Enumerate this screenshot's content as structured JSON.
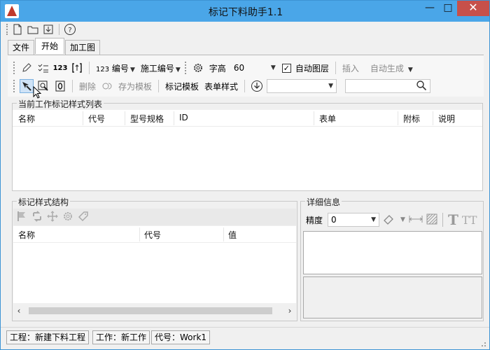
{
  "window": {
    "title": "标记下料助手1.1",
    "minimize_glyph": "—",
    "maximize_glyph": "□",
    "close_glyph": "✕"
  },
  "quick_access": {
    "icons": [
      "new-file-icon",
      "open-folder-icon",
      "save-icon",
      "help-icon"
    ],
    "help_glyph": "?"
  },
  "tabs": [
    {
      "label": "文件",
      "active": false
    },
    {
      "label": "开始",
      "active": true
    },
    {
      "label": "加工图",
      "active": false
    }
  ],
  "ribbon": {
    "row1": {
      "number_btn": "编号",
      "number_prefix": "123",
      "construction_number_btn": "施工编号",
      "font_height_label": "字高",
      "font_height_value": "60",
      "auto_layer_label": "自动图层",
      "auto_layer_checked": true,
      "insert_btn": "插入",
      "auto_generate_btn": "自动生成"
    },
    "row2": {
      "delete_btn": "删除",
      "save_template_btn": "存为模板",
      "mark_template_btn": "标记模板",
      "form_style_btn": "表单样式",
      "template_select_value": "",
      "search_value": ""
    }
  },
  "style_list": {
    "title": "当前工作标记样式列表",
    "columns": [
      "名称",
      "代号",
      "型号规格",
      "ID",
      "表单",
      "附标",
      "说明"
    ]
  },
  "style_structure": {
    "title": "标记样式结构",
    "columns": [
      "名称",
      "代号",
      "值"
    ],
    "toolbar_icons": [
      "flag-icon",
      "refresh-icon",
      "move-icon",
      "settings-icon",
      "tag-icon"
    ]
  },
  "detail": {
    "title": "详细信息",
    "precision_label": "精度",
    "precision_value": "0"
  },
  "status": {
    "project": "工程：新建下料工程",
    "work": "工作：新工作",
    "code": "代号：Work1"
  }
}
